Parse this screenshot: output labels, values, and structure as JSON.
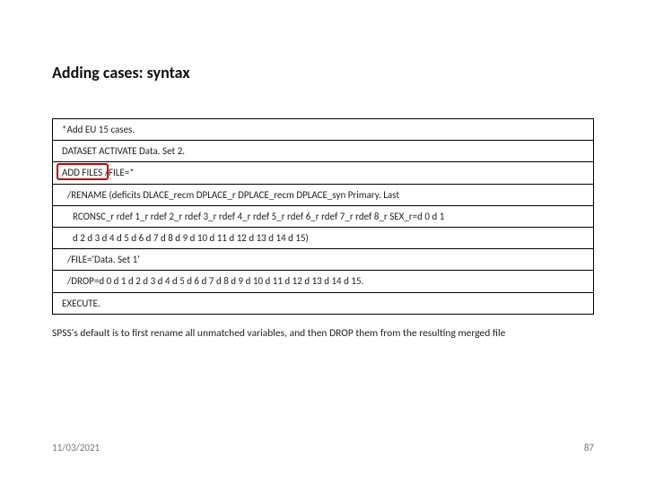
{
  "title": "Adding cases: syntax",
  "code": {
    "l1": "*Add EU 15 cases.",
    "l2": "DATASET ACTIVATE Data. Set 2.",
    "l3": "ADD FILES /FILE=*",
    "l4": "/RENAME (deficits DLACE_recm DPLACE_r DPLACE_recm DPLACE_syn Primary. Last",
    "l5": "RCONSC_r rdef 1_r rdef 2_r rdef 3_r rdef 4_r rdef 5_r rdef 6_r rdef 7_r rdef 8_r SEX_r=d 0 d 1",
    "l6": "d 2 d 3 d 4 d 5 d 6 d 7 d 8 d 9 d 10 d 11 d 12 d 13 d 14 d 15)",
    "l7": "/FILE='Data. Set 1'",
    "l8": "/DROP=d 0 d 1 d 2 d 3 d 4 d 5 d 6 d 7 d 8 d 9 d 10 d 11 d 12 d 13 d 14 d 15.",
    "l9": "EXECUTE."
  },
  "caption": "SPSS's default is to first rename all unmatched variables, and then DROP them from the resulting merged file",
  "footer": {
    "date": "11/03/2021",
    "page": "87"
  }
}
